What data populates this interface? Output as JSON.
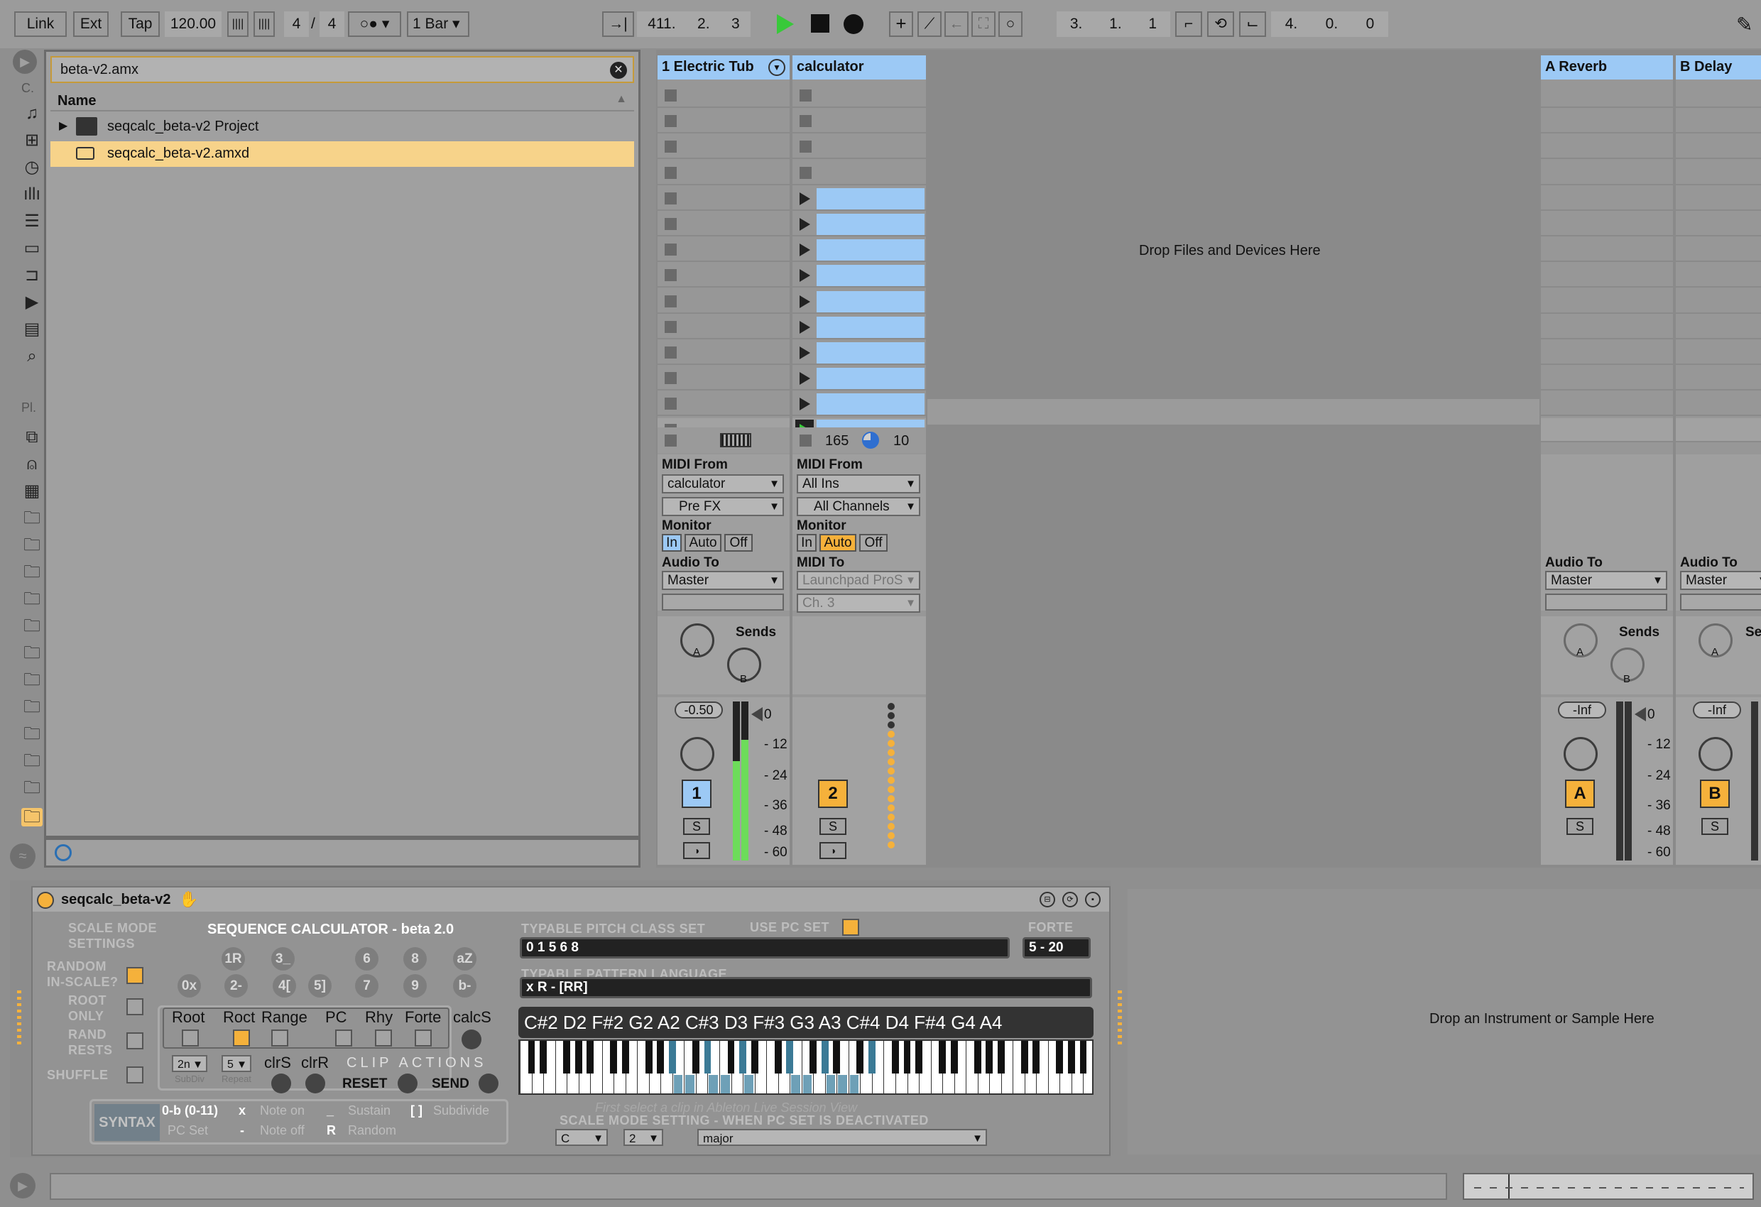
{
  "transport": {
    "link": "Link",
    "ext": "Ext",
    "tap": "Tap",
    "tempo": "120.00",
    "meter_num": "4",
    "meter_den": "4",
    "quantize": "1 Bar",
    "position": [
      "411.",
      "2.",
      "3"
    ],
    "loop_start": [
      "3.",
      "1.",
      "1"
    ],
    "loop_length": [
      "4.",
      "0.",
      "0"
    ]
  },
  "browser": {
    "search_value": "beta-v2.amx",
    "column_header": "Name",
    "category_label_top": "C.",
    "places_label": "Pl.",
    "items": [
      {
        "label": "seqcalc_beta-v2 Project",
        "selected": false
      },
      {
        "label": "seqcalc_beta-v2.amxd",
        "selected": true
      }
    ]
  },
  "session": {
    "drop_hint": "Drop Files and Devices Here",
    "tracks": [
      {
        "name": "1 Electric Tub",
        "midi_from_label": "MIDI From",
        "midi_from": "calculator",
        "midi_from_sub": "Pre FX",
        "monitor_label": "Monitor",
        "monitor": [
          "In",
          "Auto",
          "Off"
        ],
        "monitor_active": "In",
        "output_label": "Audio To",
        "output": "Master",
        "sends_label": "Sends",
        "volume": "-0.50",
        "number": "1",
        "solo": "S"
      },
      {
        "name": "calculator",
        "midi_from_label": "MIDI From",
        "midi_from": "All Ins",
        "midi_from_sub": "All Channels",
        "monitor_label": "Monitor",
        "monitor": [
          "In",
          "Auto",
          "Off"
        ],
        "monitor_active": "Auto",
        "output_label": "MIDI To",
        "output": "Launchpad ProS",
        "output_sub": "Ch. 3",
        "number": "2",
        "solo": "S",
        "io_a": "165",
        "io_b": "10"
      },
      {
        "name": "A Reverb",
        "output_label": "Audio To",
        "output": "Master",
        "sends_label": "Sends",
        "volume": "-Inf",
        "number": "A",
        "solo": "S"
      },
      {
        "name": "B Delay",
        "output_label": "Audio To",
        "output": "Master",
        "sends_label": "Se",
        "volume": "-Inf",
        "number": "B",
        "solo": "S"
      }
    ],
    "knob_a": "A",
    "knob_b": "B",
    "meter_scale": [
      "0",
      "12",
      "24",
      "36",
      "48",
      "60"
    ]
  },
  "device": {
    "title": "seqcalc_beta-v2",
    "scale_mode_settings": "SCALE MODE\nSETTINGS",
    "heading": "SEQUENCE CALCULATOR - beta 2.0",
    "random_in_scale": "RANDOM\nIN-SCALE?",
    "root_only": "ROOT\nONLY",
    "rand_rests": "RAND\nRESTS",
    "shuffle": "SHUFFLE",
    "round_buttons_top": [
      "1R",
      "3_",
      "6",
      "8",
      "aZ"
    ],
    "round_buttons_bottom": [
      "0x",
      "2-",
      "4[",
      "5]",
      "7",
      "9",
      "b-"
    ],
    "toggles": [
      "Root",
      "Roct",
      "Range",
      "PC",
      "Rhy",
      "Forte",
      "calcS"
    ],
    "subdiv": "2n",
    "subdiv_label": "SubDiv",
    "repeat": "5",
    "repeat_label": "Repeat",
    "clrS": "clrS",
    "clrR": "clrR",
    "clip_actions": "CLIP  ACTIONS",
    "reset": "RESET",
    "send": "SEND",
    "syntax": "SYNTAX",
    "syntax_rows": [
      [
        "0-b (0-11)",
        "x",
        "Note on",
        "_",
        "Sustain",
        "[ ]",
        "Subdivide"
      ],
      [
        "PC Set",
        "-",
        "Note off",
        "R",
        "Random",
        "",
        ""
      ]
    ],
    "typable_pc_label": "TYPABLE PITCH CLASS SET",
    "use_pc_set": "USE PC SET",
    "forte_label": "FORTE",
    "pc_set_value": "0 1 5 6 8",
    "forte_value": "5 - 20",
    "pattern_label": "TYPABLE PATTERN LANGUAGE",
    "pattern_value": "x R - [RR]",
    "notes": "C#2 D2 F#2 G2 A2 C#3 D3 F#3 G3 A3 C#4 D4 F#4 G4 A4",
    "hint": "First select a clip in Ableton Live Session View",
    "scale_mode_label": "SCALE MODE SETTING - WHEN PC SET IS DEACTIVATED",
    "scale_root": "C",
    "scale_oct": "2",
    "scale_name": "major",
    "instrument_drop": "Drop an Instrument or Sample Here"
  },
  "colors": {
    "accent_orange": "#f5b13b",
    "clip_blue": "#9cc9f5",
    "selected_yellow": "#f7d38a",
    "meter_green": "#6ddc5a"
  }
}
